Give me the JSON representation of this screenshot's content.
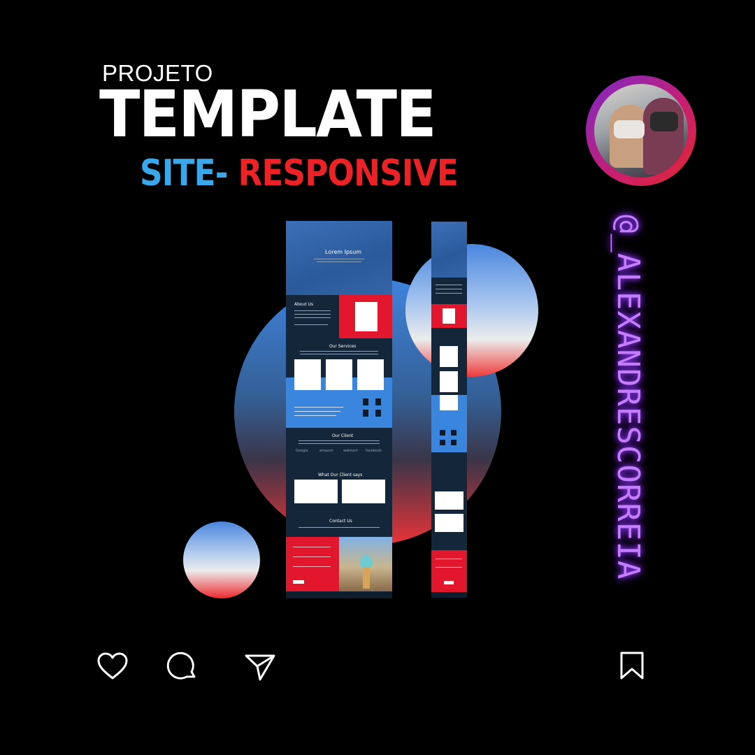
{
  "title": {
    "line1": "PROJETO",
    "line2": "TEMPLATE",
    "line3_part1": "SITE-",
    "line3_part2": " RESPONSIVE"
  },
  "handle": "@_ALEXANDRESCORREIA",
  "mockup": {
    "hero_title": "Lorem Ipsum",
    "about": "About Us",
    "services": "Our Services",
    "clients": "Our Client",
    "testimonials": "What Our Client says",
    "contact": "Contact Us",
    "brands": [
      "Google",
      "amazon",
      "walmart",
      "facebook"
    ]
  },
  "actions": {
    "like_icon": "heart-icon",
    "comment_icon": "comment-icon",
    "share_icon": "send-icon",
    "save_icon": "bookmark-icon"
  },
  "colors": {
    "accent_blue": "#39a7ea",
    "accent_red": "#ec2227",
    "handle_purple": "#c47dff"
  }
}
